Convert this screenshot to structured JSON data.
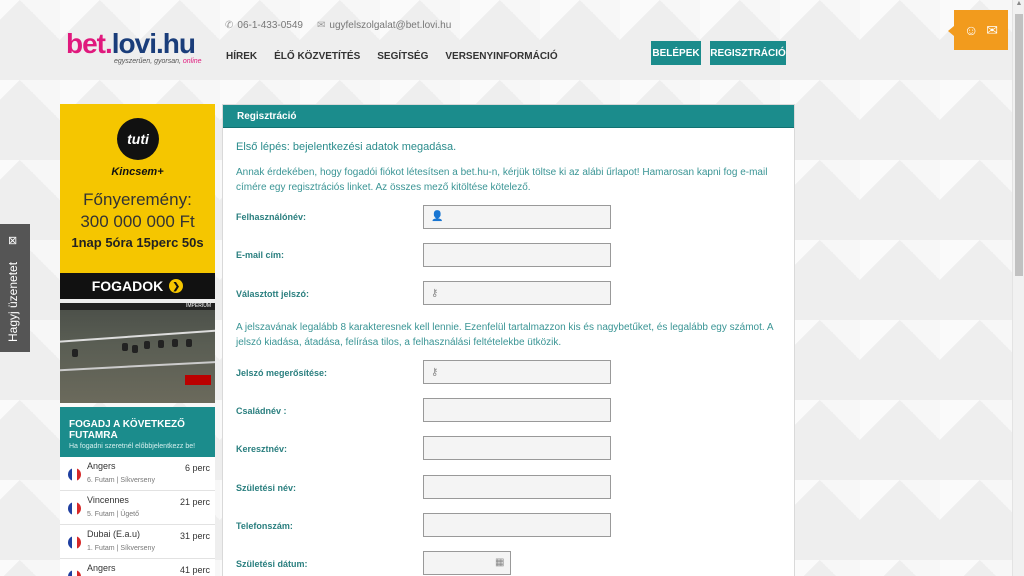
{
  "header": {
    "phone": "06-1-433-0549",
    "email": "ugyfelszolgalat@bet.lovi.hu",
    "logo_part1": "bet.",
    "logo_part2": "lovi.hu",
    "slogan_main": "egyszerűen, gyorsan, ",
    "slogan_hl": "online",
    "nav": [
      "HÍREK",
      "ÉLŐ KÖZVETÍTÉS",
      "SEGÍTSÉG",
      "VERSENYINFORMÁCIÓ"
    ],
    "login_label": "BELÉPEK",
    "register_label": "REGISZTRÁCIÓ"
  },
  "feedback_tab": {
    "label": "Hagyj üzenetet"
  },
  "promo": {
    "brand": "tuti",
    "sub_brand": "Kincsem+",
    "prize_label": "Főnyeremény:",
    "prize_amount": "300 000 000 Ft",
    "countdown": "1nap 5óra 15perc 50s",
    "cta": "FOGADOK",
    "video_tag": "IMPERIUM"
  },
  "next_race": {
    "title": "FOGADJ A KÖVETKEZŐ FUTAMRA",
    "subtitle": "Ha fogadni szeretnél előbbjelentkezz be!",
    "races": [
      {
        "name": "Angers",
        "sub": "6. Futam | Síkverseny",
        "time": "6 perc"
      },
      {
        "name": "Vincennes",
        "sub": "5. Futam | Ügető",
        "time": "21 perc"
      },
      {
        "name": "Dubai (E.a.u)",
        "sub": "1. Futam | Síkverseny",
        "time": "31 perc"
      },
      {
        "name": "Angers",
        "sub": "",
        "time": "41 perc"
      }
    ]
  },
  "form": {
    "title": "Regisztráció",
    "step": "Első lépés: bejelentkezési adatok megadása.",
    "intro": "Annak érdekében, hogy fogadói fiókot létesítsen a bet.hu-n, kérjük töltse ki az alábi űrlapot! Hamarosan kapni fog e-mail címére egy regisztrációs linket. Az összes mező kitöltése kötelező.",
    "password_note": "A jelszavának legalább 8 karakteresnek kell lennie. Ezenfelül tartalmazzon kis és nagybetűket, és legalább egy számot. A jelszó kiadása, átadása, felírása tilos, a felhasználási feltételekbe ütközik.",
    "fields": {
      "username": "Felhasználónév:",
      "email": "E-mail cím:",
      "password": "Választott jelszó:",
      "password_confirm": "Jelszó megerősítése:",
      "lastname": "Családnév :",
      "firstname": "Keresztnév:",
      "birthname": "Születési név:",
      "phone": "Telefonszám:",
      "birthdate": "Születési dátum:"
    }
  }
}
